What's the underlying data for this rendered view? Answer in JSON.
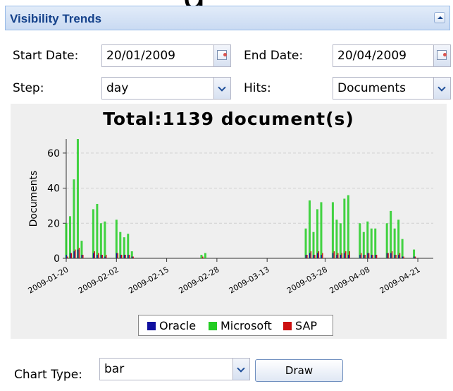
{
  "panel": {
    "title": "Visibility Trends"
  },
  "form": {
    "start_label": "Start Date:",
    "start_value": "20/01/2009",
    "end_label": "End Date:",
    "end_value": "20/04/2009",
    "step_label": "Step:",
    "step_value": "day",
    "hits_label": "Hits:",
    "hits_value": "Documents"
  },
  "chart_data": {
    "type": "bar",
    "title": "Total:1139 document(s)",
    "xlabel": "",
    "ylabel": "Documents",
    "ylim": [
      0,
      68
    ],
    "yticks": [
      0,
      20,
      40,
      60
    ],
    "grid": true,
    "legend_placement": "bottom",
    "x_start": "2009-01-20",
    "x_end": "2009-04-25",
    "xtick_labels": [
      "2009-01-20",
      "2009-02-02",
      "2009-02-15",
      "2009-02-28",
      "2009-03-13",
      "2009-03-28",
      "2009-04-08",
      "2009-04-21"
    ],
    "series": [
      {
        "name": "Oracle",
        "color": "#1010a0",
        "points": [
          [
            "2009-01-20",
            2
          ],
          [
            "2009-01-21",
            3
          ],
          [
            "2009-01-22",
            4
          ],
          [
            "2009-01-23",
            5
          ],
          [
            "2009-01-24",
            2
          ],
          [
            "2009-01-27",
            3
          ],
          [
            "2009-01-28",
            2
          ],
          [
            "2009-01-29",
            2
          ],
          [
            "2009-01-30",
            1
          ],
          [
            "2009-02-02",
            3
          ],
          [
            "2009-02-03",
            2
          ],
          [
            "2009-02-04",
            2
          ],
          [
            "2009-02-05",
            2
          ],
          [
            "2009-02-06",
            1
          ],
          [
            "2009-03-23",
            2
          ],
          [
            "2009-03-24",
            3
          ],
          [
            "2009-03-25",
            2
          ],
          [
            "2009-03-26",
            3
          ],
          [
            "2009-03-27",
            2
          ],
          [
            "2009-03-30",
            3
          ],
          [
            "2009-03-31",
            2
          ],
          [
            "2009-04-01",
            2
          ],
          [
            "2009-04-02",
            3
          ],
          [
            "2009-04-03",
            2
          ],
          [
            "2009-04-06",
            2
          ],
          [
            "2009-04-07",
            2
          ],
          [
            "2009-04-08",
            3
          ],
          [
            "2009-04-09",
            2
          ],
          [
            "2009-04-10",
            2
          ],
          [
            "2009-04-13",
            3
          ],
          [
            "2009-04-14",
            3
          ],
          [
            "2009-04-15",
            2
          ],
          [
            "2009-04-16",
            2
          ],
          [
            "2009-04-17",
            1
          ],
          [
            "2009-04-20",
            1
          ]
        ]
      },
      {
        "name": "Microsoft",
        "color": "#22cc22",
        "points": [
          [
            "2009-01-20",
            20
          ],
          [
            "2009-01-21",
            24
          ],
          [
            "2009-01-22",
            45
          ],
          [
            "2009-01-23",
            68
          ],
          [
            "2009-01-24",
            10
          ],
          [
            "2009-01-27",
            28
          ],
          [
            "2009-01-28",
            31
          ],
          [
            "2009-01-29",
            20
          ],
          [
            "2009-01-30",
            21
          ],
          [
            "2009-02-02",
            22
          ],
          [
            "2009-02-03",
            15
          ],
          [
            "2009-02-04",
            12
          ],
          [
            "2009-02-05",
            14
          ],
          [
            "2009-02-06",
            4
          ],
          [
            "2009-02-24",
            2
          ],
          [
            "2009-02-25",
            3
          ],
          [
            "2009-03-23",
            17
          ],
          [
            "2009-03-24",
            33
          ],
          [
            "2009-03-25",
            15
          ],
          [
            "2009-03-26",
            28
          ],
          [
            "2009-03-27",
            32
          ],
          [
            "2009-03-30",
            32
          ],
          [
            "2009-03-31",
            22
          ],
          [
            "2009-04-01",
            20
          ],
          [
            "2009-04-02",
            34
          ],
          [
            "2009-04-03",
            36
          ],
          [
            "2009-04-06",
            20
          ],
          [
            "2009-04-07",
            15
          ],
          [
            "2009-04-08",
            21
          ],
          [
            "2009-04-09",
            17
          ],
          [
            "2009-04-10",
            17
          ],
          [
            "2009-04-13",
            20
          ],
          [
            "2009-04-14",
            27
          ],
          [
            "2009-04-15",
            17
          ],
          [
            "2009-04-16",
            22
          ],
          [
            "2009-04-17",
            11
          ],
          [
            "2009-04-20",
            5
          ]
        ]
      },
      {
        "name": "SAP",
        "color": "#cc1010",
        "points": [
          [
            "2009-01-20",
            1
          ],
          [
            "2009-01-21",
            3
          ],
          [
            "2009-01-22",
            5
          ],
          [
            "2009-01-23",
            6
          ],
          [
            "2009-01-24",
            2
          ],
          [
            "2009-01-27",
            4
          ],
          [
            "2009-01-28",
            3
          ],
          [
            "2009-01-29",
            2
          ],
          [
            "2009-01-30",
            2
          ],
          [
            "2009-02-02",
            3
          ],
          [
            "2009-02-03",
            2
          ],
          [
            "2009-02-04",
            2
          ],
          [
            "2009-02-05",
            2
          ],
          [
            "2009-02-06",
            1
          ],
          [
            "2009-02-24",
            1
          ],
          [
            "2009-03-23",
            2
          ],
          [
            "2009-03-24",
            4
          ],
          [
            "2009-03-25",
            2
          ],
          [
            "2009-03-26",
            4
          ],
          [
            "2009-03-27",
            3
          ],
          [
            "2009-03-30",
            4
          ],
          [
            "2009-03-31",
            3
          ],
          [
            "2009-04-01",
            3
          ],
          [
            "2009-04-02",
            4
          ],
          [
            "2009-04-03",
            4
          ],
          [
            "2009-04-06",
            3
          ],
          [
            "2009-04-07",
            2
          ],
          [
            "2009-04-08",
            3
          ],
          [
            "2009-04-09",
            2
          ],
          [
            "2009-04-10",
            2
          ],
          [
            "2009-04-13",
            3
          ],
          [
            "2009-04-14",
            4
          ],
          [
            "2009-04-15",
            2
          ],
          [
            "2009-04-16",
            3
          ],
          [
            "2009-04-17",
            1
          ],
          [
            "2009-04-20",
            1
          ]
        ]
      }
    ]
  },
  "bottom": {
    "chart_type_label": "Chart Type:",
    "chart_type_value": "bar",
    "draw_label": "Draw"
  },
  "icons": {
    "date_trigger": "calendar-icon",
    "combo_trigger": "chevron-down-icon",
    "collapse": "collapse-icon"
  },
  "colors": {
    "header_text": "#15428b",
    "header_bg": "#c9daf2",
    "panel_bg": "#efefef"
  }
}
